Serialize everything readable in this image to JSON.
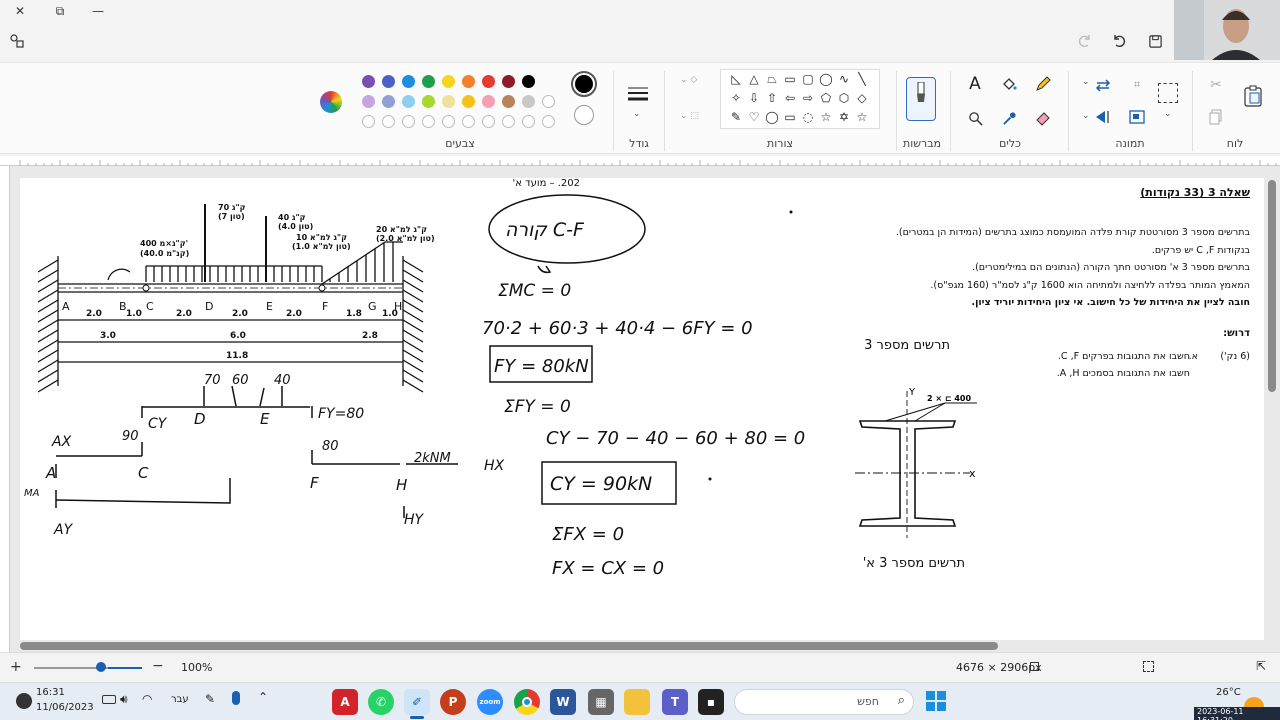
{
  "ribbon": {
    "groups": {
      "colors": "צבעים",
      "size": "גודל",
      "shapes": "צורות",
      "brushes": "מברשות",
      "tools": "כלים",
      "image": "תמונה",
      "clipboard": "לוח"
    },
    "palette_row1": [
      "#7b4fb0",
      "#4b5fc8",
      "#1a8fe0",
      "#1da04a",
      "#f7d51b",
      "#f4812a",
      "#e33b32",
      "#8e1a2b",
      "#000000"
    ],
    "palette_row2": [
      "#c6a6e2",
      "#8ea0d6",
      "#8ecff0",
      "#a8d72d",
      "#f2e19a",
      "#f5c21a",
      "#f3a0b7",
      "#b9845a",
      "#c8c8c8",
      "#ffffff"
    ],
    "primary_color": "#000000",
    "secondary_color": "#ffffff"
  },
  "document": {
    "header_date": "202. – מועד א'",
    "question_title": "שאלה 3 (33 נקודות)",
    "text_lines": [
      "בתרשים מספר 3 מסורטטת קורת פלדה המועמסת כמוצג בתרשים (המידות הן במטרים).",
      "בנקודות C ,F יש פרקים.",
      "בתרשים מספר 3 א' מסורטט חתך הקורה (הנתונים הם במילימטרים).",
      "המאמץ המותר בפלדה ללחיצה ולמתיחה הוא 1600 ק\"ג לסמ\"ר (160 מגפ\"ס).",
      "חובה לציין את היחידות של כל חישוב. אי ציון היחידות יוריד ציון."
    ],
    "required_label": "דרוש:",
    "task_a_points": "(6 נק')",
    "task_a_letter": "א.",
    "task_a_text": "חשבו את התגובות בפרקים C ,F.",
    "task_b_text": "חשבו את התגובות בסמכים A ,H.",
    "figure3_title": "תרשים מספר 3",
    "figure3a_title": "תרשים מספר 3 א'",
    "section_label_top": "2 × ⊏ 400",
    "section_axis_y": "Y",
    "section_axis_x": "x",
    "beam_points": [
      "A",
      "B",
      "C",
      "D",
      "E",
      "F",
      "G",
      "H"
    ],
    "beam_dims_row1": [
      "2.0",
      "1.0",
      "2.0",
      "2.0",
      "2.0",
      "1.8",
      "1.0"
    ],
    "beam_dims_row2": [
      "3.0",
      "6.0",
      "2.8"
    ],
    "beam_total": "11.8",
    "loads": {
      "moment": "400 ק\"ג×מ'",
      "moment2": "(40.0 קנ\"מ)",
      "p70a": "70 ק\"ג",
      "p70b": "(7 טון)",
      "p40a": "40 ק\"ג",
      "p40b": "(4.0 טון)",
      "q10a": "10 ק\"ג למ\"א",
      "q10b": "(1.0 טון למ\"א)",
      "q20a": "20 ק\"ג למ\"א",
      "q20b": "(2.0 טון למ\"א)"
    }
  },
  "handwriting": {
    "beam_label": "קורה  C-F",
    "sum_mc": "ΣMC = 0",
    "eq1": "70·2 + 60·3 + 40·4 − 6FY = 0",
    "fy_result": "FY = 80kN",
    "sum_fy": "ΣFY = 0",
    "eq2": "CY − 70 − 40 − 60 + 80 = 0",
    "cy_result": "CY = 90kN",
    "sum_fx": "ΣFX = 0",
    "fx_eq": "FX = CX = 0",
    "fbd_loads": [
      "70",
      "60",
      "40"
    ],
    "fbd_cy": "CY",
    "fbd_d": "D",
    "fbd_e": "E",
    "fbd_fy": "FY=80",
    "left_ax": "AX",
    "left_a": "A",
    "left_ay": "AY",
    "left_ma": "MA",
    "left_90": "90",
    "left_c": "C",
    "right_80": "80",
    "right_f": "F",
    "right_mom": "2kNM",
    "right_h": "H",
    "right_hx": "HX",
    "right_hy": "HY"
  },
  "statusbar": {
    "zoom": "100%",
    "dimensions": "4676 × 2906px"
  },
  "taskbar": {
    "time": "16:31",
    "date": "11/06/2023",
    "lang": "עבר",
    "search_placeholder": "חפש",
    "weather": "26°C",
    "recording_stamp": "2023-06-11 16:31:20"
  }
}
